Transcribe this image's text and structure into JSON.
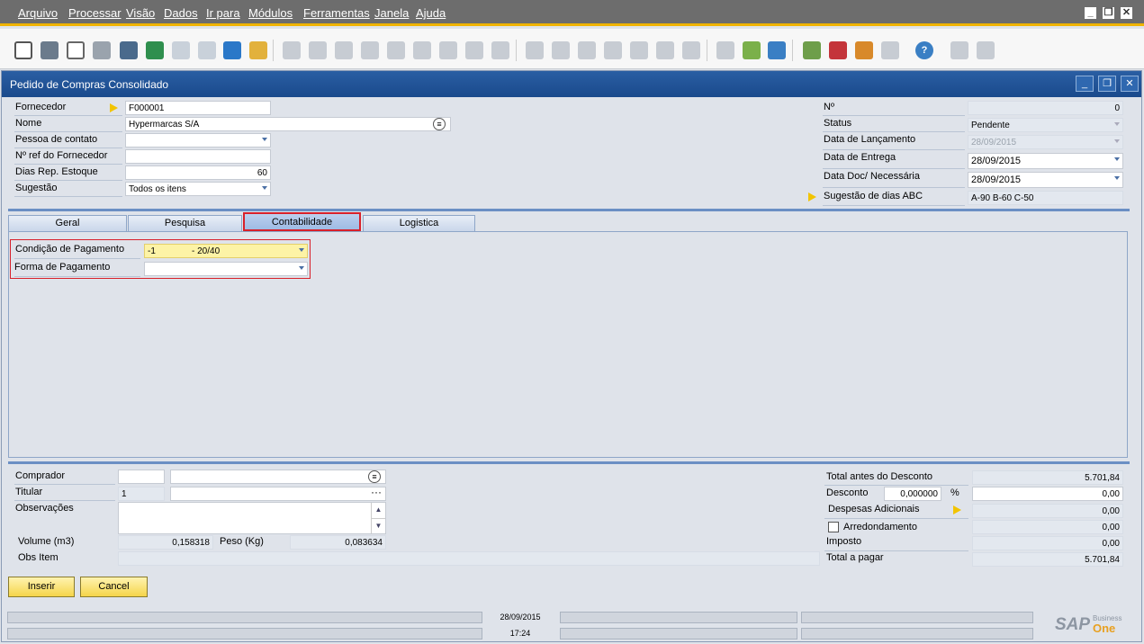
{
  "menu": [
    "Arquivo",
    "Processar",
    "Visão",
    "Dados",
    "Ir para",
    "Módulos",
    "Ferramentas",
    "Janela",
    "Ajuda"
  ],
  "window": {
    "title": "Pedido de Compras Consolidado"
  },
  "header_left": {
    "fornecedor_label": "Fornecedor",
    "fornecedor_value": "F000001",
    "nome_label": "Nome",
    "nome_value": "Hypermarcas S/A",
    "contato_label": "Pessoa de contato",
    "contato_value": "",
    "nref_label": "Nº ref do Fornecedor",
    "nref_value": "",
    "dias_label": "Dias Rep. Estoque",
    "dias_value": "60",
    "sugestao_label": "Sugestão",
    "sugestao_value": "Todos os itens"
  },
  "header_right": {
    "num_label": "Nº",
    "num_value": "0",
    "status_label": "Status",
    "status_value": "Pendente",
    "lanc_label": "Data de Lançamento",
    "lanc_value": "28/09/2015",
    "entrega_label": "Data de Entrega",
    "entrega_value": "28/09/2015",
    "doc_label": "Data Doc/ Necessária",
    "doc_value": "28/09/2015",
    "abc_label": "Sugestão de dias ABC",
    "abc_value": "A-90 B-60 C-50"
  },
  "tabs": [
    "Geral",
    "Pesquisa",
    "Contabilidade",
    "Logistica"
  ],
  "contab": {
    "cond_label": "Condição de Pagamento",
    "cond_code": "-1",
    "cond_value": "- 20/40",
    "forma_label": "Forma de Pagamento",
    "forma_value": ""
  },
  "footer_left": {
    "comprador_label": "Comprador",
    "comprador_value": "",
    "titular_label": "Titular",
    "titular_value": "1",
    "obs_label": "Observações",
    "obs_value": "",
    "volume_label": "Volume (m3)",
    "volume_value": "0,158318",
    "peso_label": "Peso (Kg)",
    "peso_value": "0,083634",
    "obsitem_label": "Obs Item",
    "obsitem_value": ""
  },
  "footer_right": {
    "total_antes_label": "Total antes do Desconto",
    "total_antes_value": "5.701,84",
    "desconto_label": "Desconto",
    "desconto_pct": "0,000000",
    "pct_sign": "%",
    "desconto_value": "0,00",
    "despesas_label": "Despesas Adicionais",
    "despesas_value": "0,00",
    "arred_label": "Arredondamento",
    "arred_value": "0,00",
    "imposto_label": "Imposto",
    "imposto_value": "0,00",
    "total_label": "Total a pagar",
    "total_value": "5.701,84"
  },
  "buttons": {
    "inserir": "Inserir",
    "cancel": "Cancel"
  },
  "statusbar": {
    "date": "28/09/2015",
    "time": "17:24"
  },
  "brand": {
    "sap": "SAP",
    "business": "Business",
    "one": "One"
  }
}
